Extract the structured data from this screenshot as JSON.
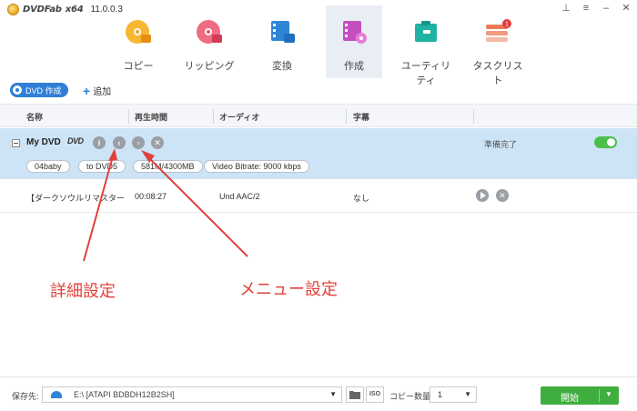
{
  "app": {
    "logo_text": "DVDFab",
    "arch": "x64",
    "version": "11.0.0.3"
  },
  "window_controls": [
    "pin-icon",
    "menu-icon",
    "minimize-icon",
    "close-icon"
  ],
  "modules": [
    {
      "label": "コピー",
      "icon": "disc-copy-icon",
      "color": "#f0a020"
    },
    {
      "label": "リッピング",
      "icon": "disc-rip-icon",
      "color": "#e9516d"
    },
    {
      "label": "変換",
      "icon": "film-convert-icon",
      "color": "#2f86d6"
    },
    {
      "label": "作成",
      "icon": "film-create-icon",
      "color": "#c64fc0",
      "active": true
    },
    {
      "label": "ユーティリティ",
      "icon": "toolbox-icon",
      "color": "#1fb3a4"
    },
    {
      "label": "タスクリスト",
      "icon": "task-list-icon",
      "color": "#ef7a5a",
      "badge": "1"
    }
  ],
  "actions": {
    "dvd_create_label": "DVD 作成",
    "add_label": "追加"
  },
  "columns": [
    "名称",
    "再生時間",
    "オーディオ",
    "字幕"
  ],
  "title_item": {
    "name": "My DVD",
    "logo": "DVD",
    "status": "準備完了",
    "enabled": true,
    "chips": [
      "04baby",
      "to DVD5",
      "581M/4300MB",
      "Video Bitrate: 9000 kbps"
    ]
  },
  "track": {
    "name": "【ダークソウルリマスター】開始...",
    "duration": "00:08:27",
    "audio": "Und AAC/2",
    "subtitle": "なし"
  },
  "annotations": {
    "advanced_settings": "詳細設定",
    "menu_settings": "メニュー設定",
    "color": "#e0413c"
  },
  "bottom": {
    "save_label": "保存先:",
    "path": "E:\\ [ATAPI BDBDH12B2SH]",
    "copies_label": "コピー数量:",
    "copies_value": "1",
    "start_label": "開始",
    "iso_label": "ISO"
  }
}
